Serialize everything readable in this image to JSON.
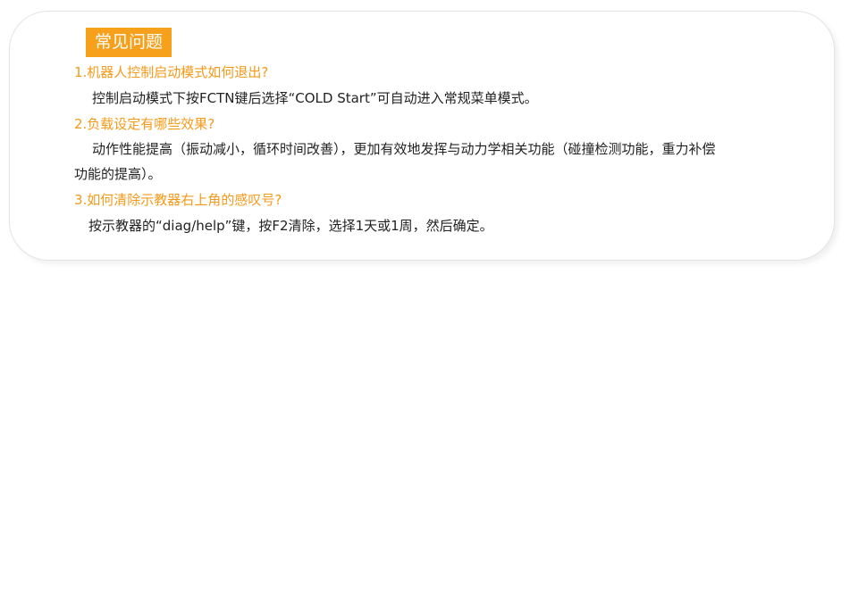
{
  "faq": {
    "title": "常见问题",
    "items": [
      {
        "question": "1.机器人控制启动模式如何退出?",
        "answer": "控制启动模式下按FCTN键后选择“COLD Start”可自动进入常规菜单模式。"
      },
      {
        "question": "2.负载设定有哪些效果?",
        "answer_line1": "动作性能提高（振动减小，循环时间改善），更加有效地发挥与动力学相关功能（碰撞检测功能，重力补偿",
        "answer_line2": "功能的提高）。"
      },
      {
        "question": "3.如何清除示教器右上角的感叹号?",
        "answer": "按示教器的“diag/help”键，按F2清除，选择1天或1周，然后确定。"
      }
    ]
  },
  "colors": {
    "accent": "#f7a01c",
    "question_text": "#f39a1a",
    "body_text": "#222222",
    "card_border": "#e3e3e3"
  }
}
